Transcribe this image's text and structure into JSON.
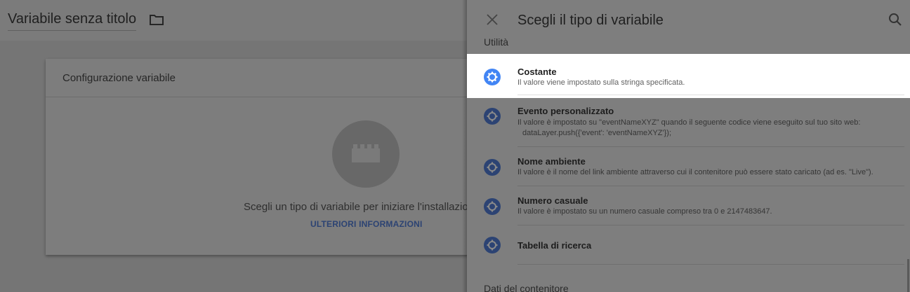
{
  "editor": {
    "title": "Variabile senza titolo",
    "card": {
      "title": "Configurazione variabile",
      "prompt": "Scegli un tipo di variabile per iniziare l'installazio",
      "link": "ULTERIORI INFORMAZIONI"
    }
  },
  "panel": {
    "title": "Scegli il tipo di variabile",
    "section_top": "Utilità",
    "section_bottom": "Dati del contenitore",
    "items": [
      {
        "name": "Costante",
        "desc": "Il valore viene impostato sulla stringa specificata."
      },
      {
        "name": "Evento personalizzato",
        "desc": "Il valore è impostato su \"eventNameXYZ\" quando il seguente codice viene eseguito sul tuo sito web:",
        "desc2": "dataLayer.push({'event': 'eventNameXYZ'});"
      },
      {
        "name": "Nome ambiente",
        "desc": "Il valore è il nome del link ambiente attraverso cui il contenitore può essere stato caricato (ad es. \"Live\")."
      },
      {
        "name": "Numero casuale",
        "desc": "Il valore è impostato su un numero casuale compreso tra 0 e 2147483647."
      },
      {
        "name": "Tabella di ricerca"
      }
    ]
  },
  "colors": {
    "accent_blue": "#4285f4",
    "link_blue_dimmed": "#2c4373"
  },
  "icons": [
    "folder-icon",
    "close-icon",
    "search-icon",
    "gear-icon",
    "lego-brick-icon"
  ]
}
